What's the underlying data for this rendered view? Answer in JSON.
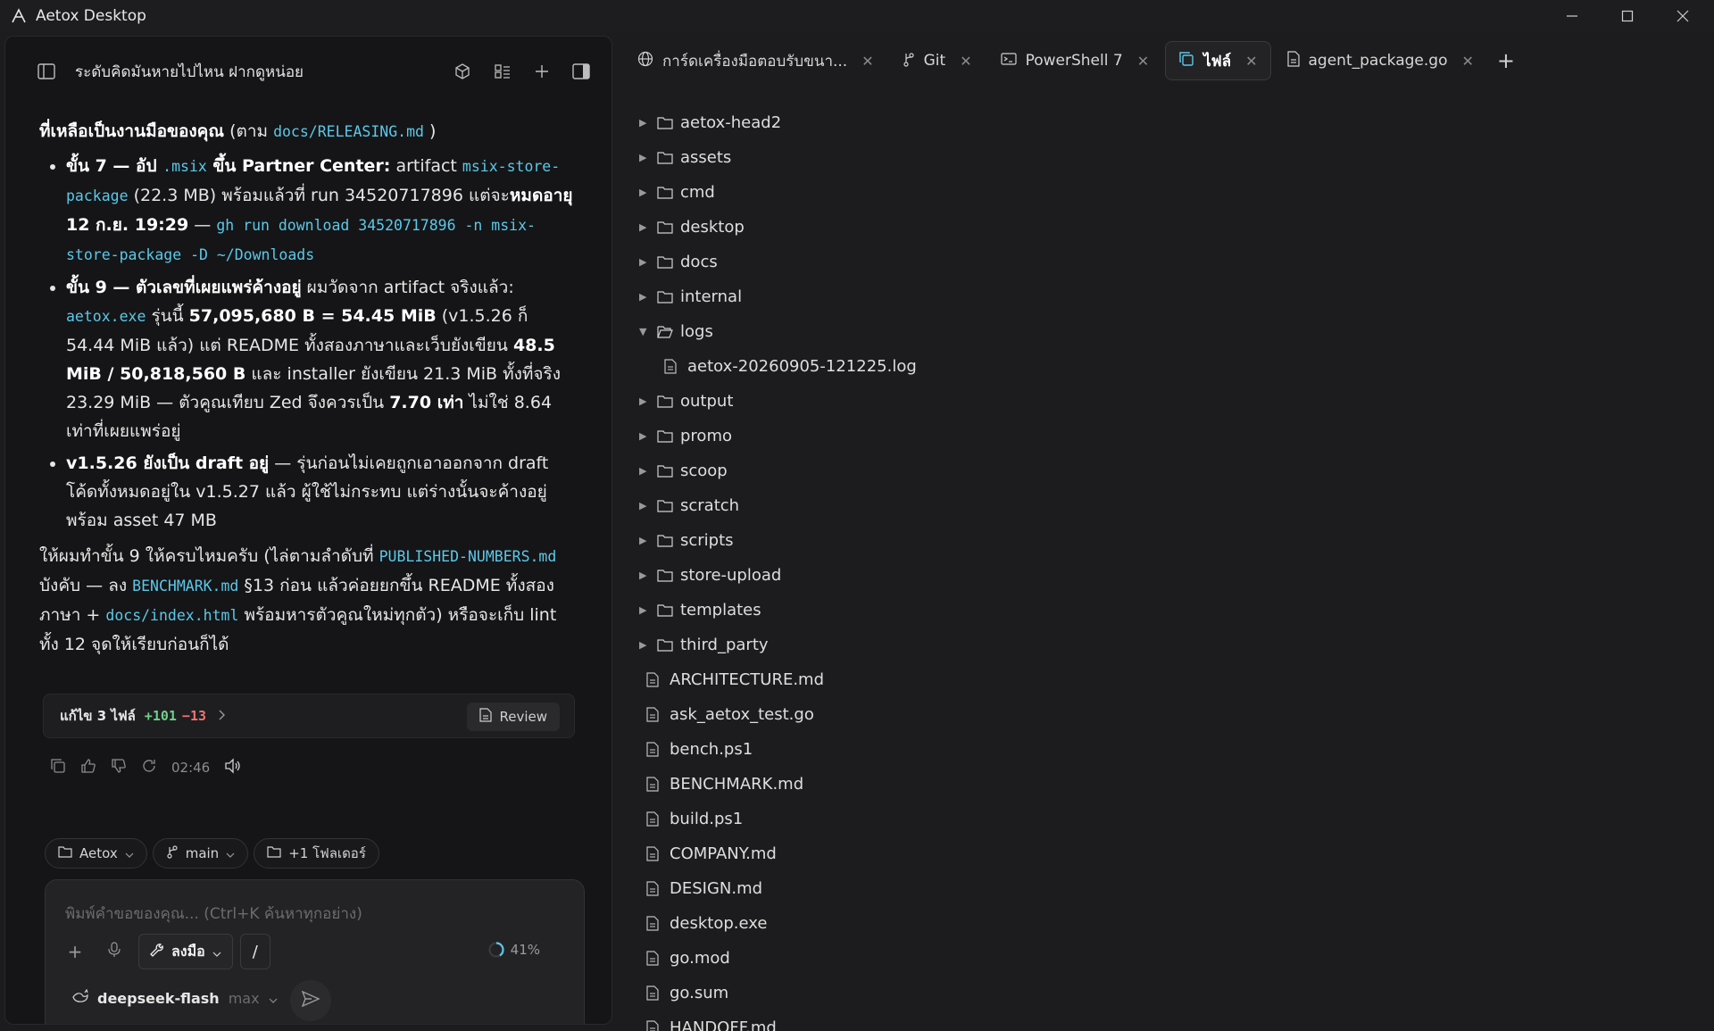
{
  "window": {
    "title": "Aetox Desktop"
  },
  "left_panel": {
    "title": "ระดับคิดมันหายไปไหน ฝากดูหน่อย",
    "chat": {
      "intro_bold": "ที่เหลือเป็นงานมือของคุณ",
      "intro_pre": " (ตาม ",
      "intro_code": "docs/RELEASING.md",
      "intro_post": " )",
      "b1_bold1": "ขั้น 7 — อัป ",
      "b1_code1": ".msix",
      "b1_bold2": " ขึ้น Partner Center:",
      "b1_t1": " artifact ",
      "b1_code2": "msix-store-package",
      "b1_t2": " (22.3 MB) พร้อมแล้วที่ run 34520717896 แต่จะ",
      "b1_bold3": "หมดอายุ 12 ก.ย. 19:29",
      "b1_t3": " — ",
      "b1_code3": "gh run download 34520717896 -n msix-store-package -D ~/Downloads",
      "b2_bold1": "ขั้น 9 — ตัวเลขที่เผยแพร่ค้างอยู่",
      "b2_t1": " ผมวัดจาก artifact จริงแล้ว: ",
      "b2_code1": "aetox.exe",
      "b2_t2": " รุ่นนี้ ",
      "b2_bold2": "57,095,680 B = 54.45 MiB",
      "b2_t3": " (v1.5.26 ก็ 54.44 MiB แล้ว) แต่ README ทั้งสองภาษาและเว็บยังเขียน ",
      "b2_bold3": "48.5 MiB / 50,818,560 B",
      "b2_t4": " และ installer ยังเขียน 21.3 MiB ทั้งที่จริง 23.29 MiB — ตัวคูณเทียบ Zed จึงควรเป็น ",
      "b2_bold4": "7.70 เท่า",
      "b2_t5": " ไม่ใช่ 8.64 เท่าที่เผยแพร่อยู่",
      "b3_bold1": "v1.5.26 ยังเป็น draft อยู่",
      "b3_t1": " — รุ่นก่อนไม่เคยถูกเอาออกจาก draft โค้ดทั้งหมดอยู่ใน v1.5.27 แล้ว ผู้ใช้ไม่กระทบ แต่ร่างนั้นจะค้างอยู่พร้อม asset 47 MB",
      "p_t1": "ให้ผมทำขั้น 9 ให้ครบไหมครับ (ไล่ตามลำดับที่ ",
      "p_code1": "PUBLISHED-NUMBERS.md",
      "p_t2": " บังคับ — ลง ",
      "p_code2": "BENCHMARK.md",
      "p_t3": " §13 ก่อน แล้วค่อยยกขึ้น README ทั้งสองภาษา + ",
      "p_code3": "docs/index.html",
      "p_t4": " พร้อมหารตัวคูณใหม่ทุกตัว) หรือจะเก็บ lint ทั้ง 12 จุดให้เรียบก่อนก็ได้"
    },
    "edits": {
      "label": "แก้ไข 3 ไฟล์",
      "added": "+101",
      "removed": "−13",
      "review_label": "Review"
    },
    "message_time": "02:46",
    "chips": [
      {
        "label": "Aetox",
        "icon": "folder-icon"
      },
      {
        "label": "main",
        "icon": "branch-icon"
      },
      {
        "label": "+1 โฟลเดอร์",
        "icon": "folder-icon"
      }
    ],
    "composer": {
      "placeholder": "พิมพ์คำขอของคุณ... (Ctrl+K ค้นหาทุกอย่าง)",
      "mode_label": "ลงมือ",
      "slash_label": "/",
      "context_percent": "41%",
      "context_fraction": 0.41,
      "model_name": "deepseek-flash",
      "effort_label": "max"
    }
  },
  "tabs": [
    {
      "label": "การ์ดเครื่องมือตอบรับขนา...",
      "icon": "globe-icon",
      "active": false
    },
    {
      "label": "Git",
      "icon": "git-icon",
      "active": false
    },
    {
      "label": "PowerShell 7",
      "icon": "terminal-icon",
      "active": false
    },
    {
      "label": "ไฟล์",
      "icon": "files-icon",
      "active": true
    },
    {
      "label": "agent_package.go",
      "icon": "file-icon",
      "active": false
    }
  ],
  "file_tree": {
    "folders": [
      "aetox-head2",
      "assets",
      "cmd",
      "desktop",
      "docs",
      "internal"
    ],
    "expanded_folder": "logs",
    "expanded_children": [
      "aetox-20260905-121225.log"
    ],
    "folders_after": [
      "output",
      "promo",
      "scoop",
      "scratch",
      "scripts",
      "store-upload",
      "templates",
      "third_party"
    ],
    "files": [
      "ARCHITECTURE.md",
      "ask_aetox_test.go",
      "bench.ps1",
      "BENCHMARK.md",
      "build.ps1",
      "COMPANY.md",
      "DESIGN.md",
      "desktop.exe",
      "go.mod",
      "go.sum",
      "HANDOFF.md"
    ]
  },
  "colors": {
    "background": "#1c1c1e",
    "panel": "#151517",
    "code": "#5cc8e8",
    "added": "#6fd08b",
    "removed": "#f07373"
  }
}
